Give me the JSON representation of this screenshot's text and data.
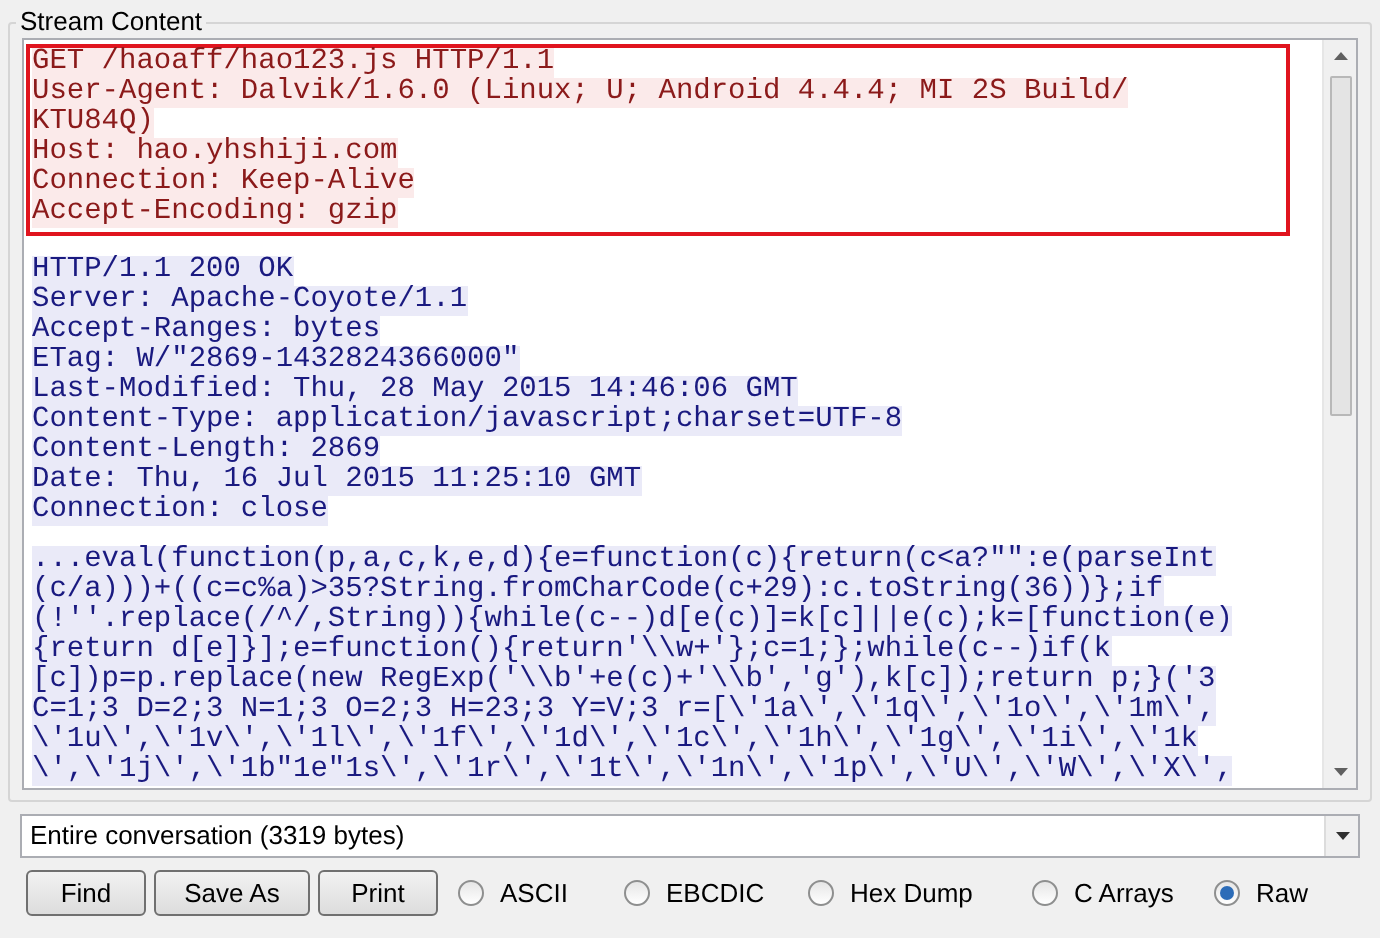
{
  "group_title": "Stream Content",
  "stream": [
    {
      "kind": "client",
      "highlighted": true,
      "lines": [
        "GET /haoaff/hao123.js HTTP/1.1",
        "User-Agent: Dalvik/1.6.0 (Linux; U; Android 4.4.4; MI 2S Build/",
        "KTU84Q)",
        "Host: hao.yhshiji.com",
        "Connection: Keep-Alive",
        "Accept-Encoding: gzip"
      ]
    },
    {
      "kind": "server",
      "highlighted": false,
      "lines": [
        "HTTP/1.1 200 OK",
        "Server: Apache-Coyote/1.1",
        "Accept-Ranges: bytes",
        "ETag: W/\"2869-1432824366000\"",
        "Last-Modified: Thu, 28 May 2015 14:46:06 GMT",
        "Content-Type: application/javascript;charset=UTF-8",
        "Content-Length: 2869",
        "Date: Thu, 16 Jul 2015 11:25:10 GMT",
        "Connection: close"
      ]
    },
    {
      "kind": "server",
      "highlighted": false,
      "lines": [
        "...eval(function(p,a,c,k,e,d){e=function(c){return(c<a?\"\":e(parseInt",
        "(c/a)))+((c=c%a)>35?String.fromCharCode(c+29):c.toString(36))};if",
        "(!''.replace(/^/,String)){while(c--)d[e(c)]=k[c]||e(c);k=[function(e)",
        "{return d[e]}];e=function(){return'\\\\w+'};c=1;};while(c--)if(k",
        "[c])p=p.replace(new RegExp('\\\\b'+e(c)+'\\\\b','g'),k[c]);return p;}('3",
        "C=1;3 D=2;3 N=1;3 O=2;3 H=23;3 Y=V;3 r=[\\'1a\\',\\'1q\\',\\'1o\\',\\'1m\\',",
        "\\'1u\\',\\'1v\\',\\'1l\\',\\'1f\\',\\'1d\\',\\'1c\\',\\'1h\\',\\'1g\\',\\'1i\\',\\'1k",
        "\\',\\'1j\\',\\'1b\"1e\"1s\\',\\'1r\\',\\'1t\\',\\'1n\\',\\'1p\\',\\'U\\',\\'W\\',\\'X\\',"
      ]
    }
  ],
  "show_select": {
    "value": "Entire conversation (3319 bytes)"
  },
  "buttons": [
    "Find",
    "Save As",
    "Print"
  ],
  "formats": [
    {
      "label": "ASCII",
      "selected": false
    },
    {
      "label": "EBCDIC",
      "selected": false
    },
    {
      "label": "Hex Dump",
      "selected": false
    },
    {
      "label": "C Arrays",
      "selected": false
    },
    {
      "label": "Raw",
      "selected": true
    }
  ]
}
